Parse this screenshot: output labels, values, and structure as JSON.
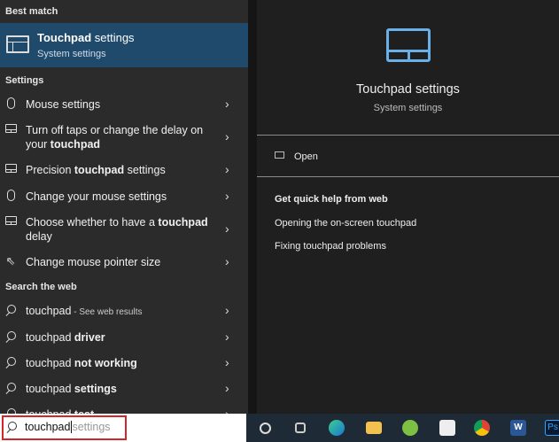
{
  "left": {
    "best_match_label": "Best match",
    "best": {
      "title_bold": "Touchpad",
      "title_rest": " settings",
      "subtitle": "System settings",
      "icon": "touchpad-icon"
    },
    "settings_label": "Settings",
    "settings_items": [
      {
        "icon": "mouse-icon",
        "pre": "Mouse settings",
        "bold": "",
        "post": ""
      },
      {
        "icon": "touchpad-icon",
        "pre": "Turn off taps or change the delay on your ",
        "bold": "touchpad",
        "post": ""
      },
      {
        "icon": "touchpad-icon",
        "pre": "Precision ",
        "bold": "touchpad",
        "post": " settings"
      },
      {
        "icon": "mouse-icon",
        "pre": "Change your mouse settings",
        "bold": "",
        "post": ""
      },
      {
        "icon": "touchpad-icon",
        "pre": "Choose whether to have a ",
        "bold": "touchpad",
        "post": " delay"
      },
      {
        "icon": "pointer-icon",
        "pre": "Change mouse pointer size",
        "bold": "",
        "post": ""
      }
    ],
    "web_label": "Search the web",
    "web_items": [
      {
        "pre": "touchpad",
        "bold": "",
        "small": " - See web results"
      },
      {
        "pre": "touchpad ",
        "bold": "driver",
        "small": ""
      },
      {
        "pre": "touchpad ",
        "bold": "not working",
        "small": ""
      },
      {
        "pre": "touchpad ",
        "bold": "settings",
        "small": ""
      },
      {
        "pre": "touchpad ",
        "bold": "test",
        "small": ""
      }
    ]
  },
  "right": {
    "title": "Touchpad settings",
    "subtitle": "System settings",
    "open_label": "Open",
    "help_heading": "Get quick help from web",
    "help_links": [
      "Opening the on-screen touchpad",
      "Fixing touchpad problems"
    ]
  },
  "search": {
    "value": "touchpad",
    "suggestion": "settings"
  },
  "taskbar": {
    "icons": [
      "cortana-icon",
      "task-view-icon",
      "edge-icon",
      "file-explorer-icon",
      "app-icon",
      "store-icon",
      "chrome-icon",
      "word-icon",
      "photoshop-icon"
    ],
    "ps_label": "Ps",
    "word_label": "W"
  },
  "colors": {
    "accent": "#1f4a6c",
    "highlight_border": "#d3262b",
    "icon_blue": "#6ab0e8"
  }
}
